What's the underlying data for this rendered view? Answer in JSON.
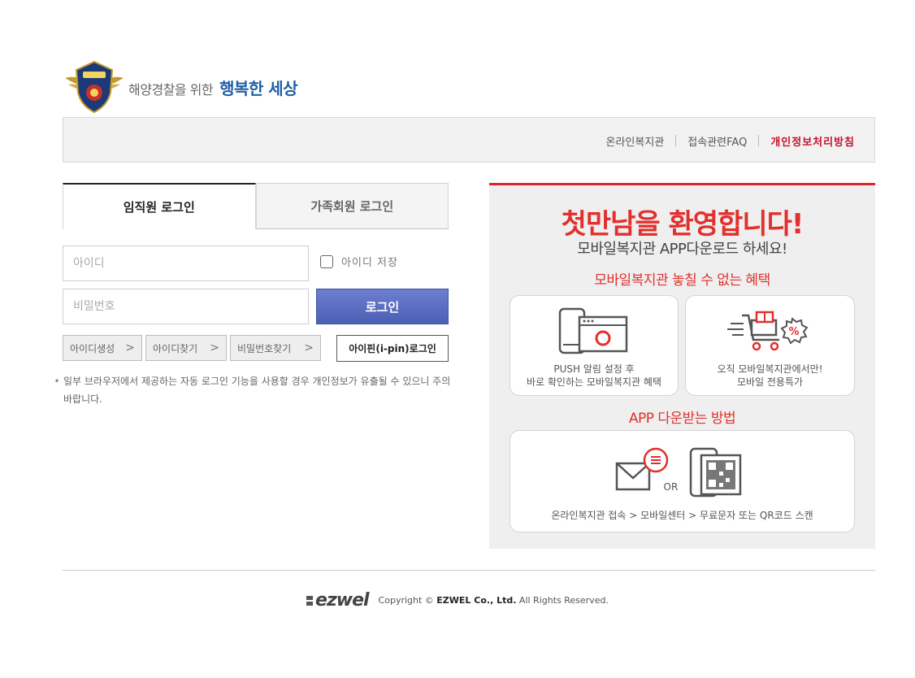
{
  "header": {
    "logo_sub": "해양경찰을 위한",
    "logo_main": "행복한 세상"
  },
  "topnav": {
    "items": [
      "온라인복지관",
      "접속관련FAQ",
      "개인정보처리방침"
    ]
  },
  "login": {
    "tabs": [
      {
        "label": "임직원 로그인",
        "active": true
      },
      {
        "label": "가족회원 로그인",
        "active": false
      }
    ],
    "id_placeholder": "아이디",
    "pw_placeholder": "비밀번호",
    "save_id_label": "아이디 저장",
    "save_id_checked": false,
    "login_button": "로그인",
    "sub_buttons": [
      "아이디생성",
      "아이디찾기",
      "비밀번호찾기"
    ],
    "ipin_button": "아이핀(i-pin)로그인",
    "notice": "일부 브라우저에서 제공하는 자동 로그인 기능을 사용할 경우 개인정보가 유출될 수 있으니 주의 바랍니다."
  },
  "promo": {
    "title": "첫만남을 환영합니다!",
    "subtitle": "모바일복지관 APP다운로드 하세요!",
    "benefit_heading": "모바일복지관 놓칠 수 없는 혜택",
    "cards": [
      {
        "line1": "PUSH 알림 설정 후",
        "line2": "바로 확인하는 모바일복지관 혜택"
      },
      {
        "line1": "오직 모바일복지관에서만!",
        "line2": "모바일 전용특가"
      }
    ],
    "app_heading": "APP 다운받는 방법",
    "or_label": "OR",
    "app_steps": "온라인복지관 접속 > 모바일센터 > 무료문자 또는 QR코드 스캔"
  },
  "footer": {
    "logo": "ezwel",
    "copyright_prefix": "Copyright ©",
    "company": "EZWEL Co., Ltd.",
    "rights": "All Rights Reserved."
  },
  "colors": {
    "accent_red": "#e2302c",
    "login_blue": "#4b5fb5",
    "logo_blue": "#1f5fa8"
  }
}
